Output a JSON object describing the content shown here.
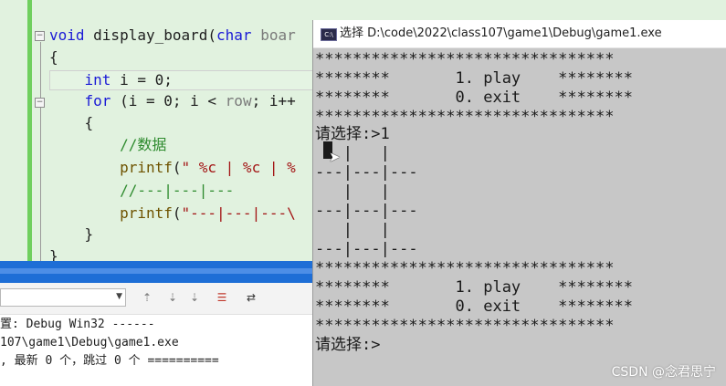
{
  "editor": {
    "lines": [
      {
        "parts": [
          {
            "t": "void",
            "c": "kw"
          },
          {
            "t": " display_board(",
            "c": "plain"
          },
          {
            "t": "char",
            "c": "kw"
          },
          {
            "t": " boar",
            "c": "grey"
          }
        ]
      },
      {
        "parts": [
          {
            "t": "{",
            "c": "plain"
          }
        ]
      },
      {
        "parts": [
          {
            "t": "    ",
            "c": "plain"
          },
          {
            "t": "int",
            "c": "kw"
          },
          {
            "t": " i = 0;",
            "c": "plain"
          }
        ]
      },
      {
        "parts": [
          {
            "t": "    ",
            "c": "plain"
          },
          {
            "t": "for",
            "c": "kw"
          },
          {
            "t": " (i = 0; i < ",
            "c": "plain"
          },
          {
            "t": "row",
            "c": "grey"
          },
          {
            "t": "; i++",
            "c": "plain"
          }
        ]
      },
      {
        "parts": [
          {
            "t": "    {",
            "c": "plain"
          }
        ]
      },
      {
        "parts": [
          {
            "t": "        ",
            "c": "plain"
          },
          {
            "t": "//数据",
            "c": "cm"
          }
        ]
      },
      {
        "parts": [
          {
            "t": "        ",
            "c": "plain"
          },
          {
            "t": "printf",
            "c": "fn"
          },
          {
            "t": "(",
            "c": "plain"
          },
          {
            "t": "\" %c | %c | %",
            "c": "str"
          }
        ]
      },
      {
        "parts": [
          {
            "t": "        ",
            "c": "plain"
          },
          {
            "t": "//---|---|---",
            "c": "cm"
          }
        ]
      },
      {
        "parts": [
          {
            "t": "        ",
            "c": "plain"
          },
          {
            "t": "printf",
            "c": "fn"
          },
          {
            "t": "(",
            "c": "plain"
          },
          {
            "t": "\"---|---|---\\",
            "c": "str"
          }
        ]
      },
      {
        "parts": [
          {
            "t": "    }",
            "c": "plain"
          }
        ]
      },
      {
        "parts": [
          {
            "t": "}",
            "c": "plain"
          }
        ]
      }
    ]
  },
  "output": {
    "lines": [
      "置: Debug Win32 ------",
      "107\\game1\\Debug\\game1.exe",
      ", 最新 0 个，跳过 0 个 =========="
    ]
  },
  "console": {
    "title": "选择 D:\\code\\2022\\class107\\game1\\Debug\\game1.exe",
    "icon_label": "C:\\",
    "lines": [
      "********************************",
      "********       1. play    ********",
      "********       0. exit    ********",
      "********************************",
      "请选择:>1",
      "   |   |",
      "---|---|---",
      "   |   |",
      "---|---|---",
      "   |   |",
      "---|---|---",
      "********************************",
      "********       1. play    ********",
      "********       0. exit    ********",
      "********************************",
      "请选择:>"
    ]
  },
  "watermark": "CSDN @念君思宁",
  "colors": {
    "editor_bg": "#e1f2df",
    "console_bg": "#c7c7c7",
    "accent_green": "#6fcf5e",
    "panel_blue": "#1e6ed6"
  }
}
